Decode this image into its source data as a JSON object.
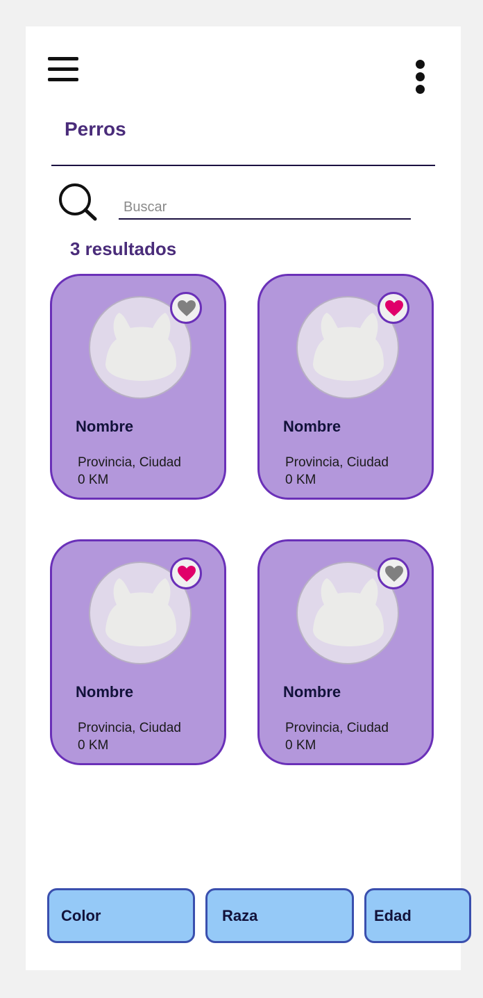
{
  "header": {
    "menu_icon": "hamburger-menu-icon",
    "more_icon": "more-vertical-icon",
    "title": "Perros"
  },
  "search": {
    "icon": "search-icon",
    "placeholder": "Buscar",
    "value": ""
  },
  "results_label": "3 resultados",
  "cards": [
    {
      "name": "Nombre",
      "location": "Provincia, Ciudad",
      "distance": "0 KM",
      "favorite": false
    },
    {
      "name": "Nombre",
      "location": "Provincia, Ciudad",
      "distance": "0 KM",
      "favorite": true
    },
    {
      "name": "Nombre",
      "location": "Provincia, Ciudad",
      "distance": "0 KM",
      "favorite": true
    },
    {
      "name": "Nombre",
      "location": "Provincia, Ciudad",
      "distance": "0 KM",
      "favorite": false
    }
  ],
  "filters": [
    {
      "label": "Color"
    },
    {
      "label": "Raza"
    },
    {
      "label": "Edad"
    }
  ],
  "colors": {
    "accent": "#4a2c7a",
    "card_bg": "#b397db",
    "card_border": "#6a30b8",
    "favorite_on": "#e0006a",
    "favorite_off": "#808080",
    "filter_bg": "#95c9f7",
    "filter_border": "#3a4fae"
  }
}
